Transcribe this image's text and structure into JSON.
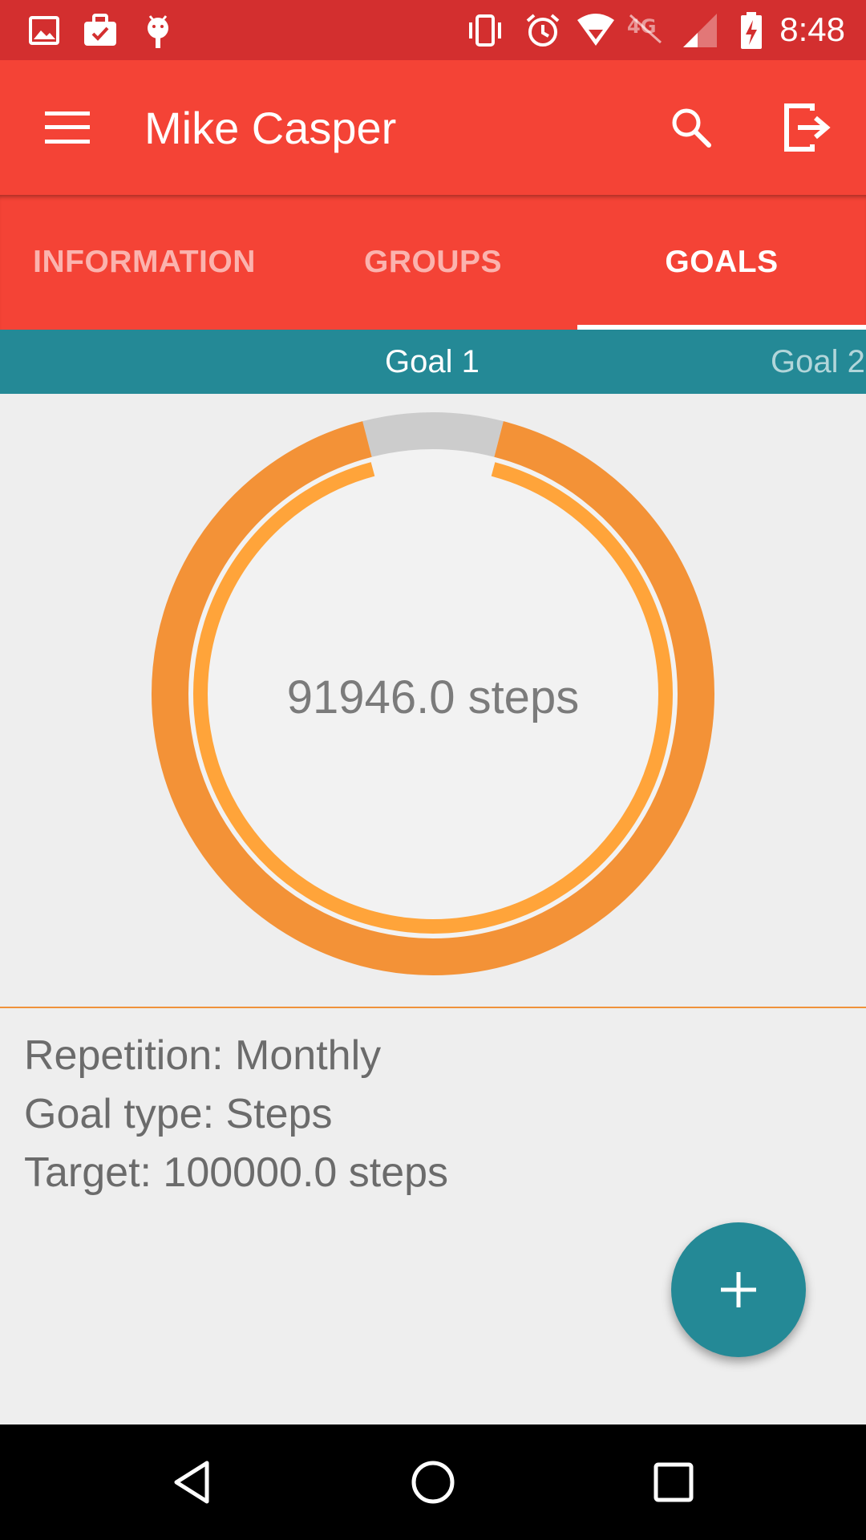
{
  "status_bar": {
    "time": "8:48",
    "left_icons": [
      "image-icon",
      "briefcase-check-icon",
      "android-icon"
    ],
    "right_icons": [
      "vibrate-icon",
      "alarm-icon",
      "wifi-icon",
      "network-4g-off-icon",
      "signal-icon",
      "battery-charging-icon"
    ]
  },
  "toolbar": {
    "title": "Mike Casper",
    "menu_icon": "menu-icon",
    "search_icon": "search-icon",
    "logout_icon": "logout-icon"
  },
  "tabs": [
    {
      "label": "INFORMATION",
      "active": false
    },
    {
      "label": "GROUPS",
      "active": false
    },
    {
      "label": "GOALS",
      "active": true
    }
  ],
  "goal_tabs": [
    {
      "label": "Goal 1",
      "active": true
    },
    {
      "label": "Goal 2",
      "active": false
    }
  ],
  "progress": {
    "value_text": "91946.0 steps",
    "current": 91946.0,
    "target": 100000.0
  },
  "details": {
    "repetition": "Repetition: Monthly",
    "goal_type": "Goal type: Steps",
    "target": "Target: 100000.0 steps"
  },
  "fab": {
    "icon": "plus-icon"
  },
  "nav_bar": {
    "icons": [
      "back-icon",
      "home-icon",
      "recents-icon"
    ]
  },
  "colors": {
    "status_bar": "#d32f2f",
    "primary": "#f44336",
    "accent": "#248996",
    "progress_outer": "#f39237",
    "progress_inner": "#ffa43a",
    "track": "#cccccc"
  }
}
